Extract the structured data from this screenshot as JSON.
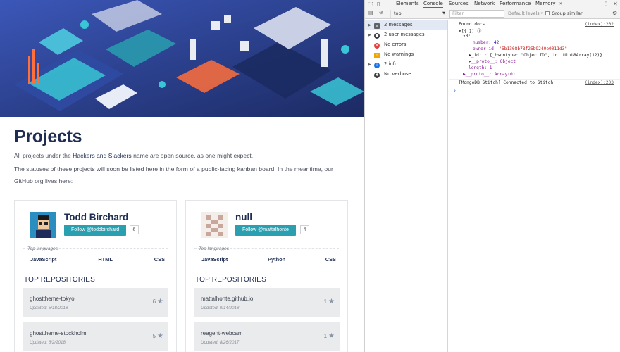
{
  "page": {
    "title": "Projects",
    "intro_prefix": "All projects under the ",
    "intro_link": "Hackers and Slackers",
    "intro_suffix": " name are open source, as one might expect.",
    "status_line1": "The statuses of these projects will soon be listed here in the form of a public-facing kanban board. In the meantime, our",
    "status_line2": "GitHub org lives here:",
    "cards": [
      {
        "name": "Todd Birchard",
        "follow_label": "Follow @toddbirchard",
        "follower_count": "6",
        "top_languages_label": "Top languages",
        "languages": [
          "JavaScript",
          "HTML",
          "CSS"
        ],
        "repos_heading": "TOP REPOSITORIES",
        "repos": [
          {
            "name": "ghosttheme-tokyo",
            "updated": "Updated: 5/18/2018",
            "stars": "6"
          },
          {
            "name": "ghosttheme-stockholm",
            "updated": "Updated: 6/2/2018",
            "stars": "5"
          }
        ]
      },
      {
        "name": "null",
        "follow_label": "Follow @mattalhonte",
        "follower_count": "4",
        "top_languages_label": "Top languages",
        "languages": [
          "JavaScript",
          "Python",
          "CSS"
        ],
        "repos_heading": "TOP REPOSITORIES",
        "repos": [
          {
            "name": "mattalhonte.github.io",
            "updated": "Updated: 9/14/2018",
            "stars": "1"
          },
          {
            "name": "reagent-webcam",
            "updated": "Updated: 8/26/2017",
            "stars": "1"
          }
        ]
      }
    ]
  },
  "devtools": {
    "tabs": [
      "Elements",
      "Console",
      "Sources",
      "Network",
      "Performance",
      "Memory"
    ],
    "active_tab": "Console",
    "more_tabs": "»",
    "context": "top",
    "filter_placeholder": "Filter",
    "levels_label": "Default levels ▾",
    "group_similar": "Group similar",
    "sidebar": [
      {
        "label": "2 messages",
        "icon": "list-icon",
        "color": "#5f6368"
      },
      {
        "label": "2 user messages",
        "icon": "user-icon",
        "color": "#5f6368"
      },
      {
        "label": "No errors",
        "icon": "error-icon",
        "color": "#e0443e"
      },
      {
        "label": "No warnings",
        "icon": "warning-icon",
        "color": "#f2a600"
      },
      {
        "label": "2 info",
        "icon": "info-icon",
        "color": "#1a73e8"
      },
      {
        "label": "No verbose",
        "icon": "bug-icon",
        "color": "#5f6368"
      }
    ],
    "console": {
      "line1": "Found docs",
      "line1_src": "(index):202",
      "line2": "▾[{…}] ⓘ",
      "line3": "▾0:",
      "number_key": "number:",
      "number_val": "42",
      "owner_key": "owner_id:",
      "owner_val": "\"5b1308b78f25b9240e0011d3\"",
      "id_line": "▶_id: r {_bsontype: \"ObjectID\", id: Uint8Array(12)}",
      "proto1": "▶__proto__: Object",
      "length_line": "length: 1",
      "proto2": "▶__proto__: Array(0)",
      "line4": "[MongoDB Stitch] Connected to Stitch",
      "line4_src": "(index):203",
      "prompt": "›"
    }
  },
  "colors": {
    "accent": "#2a9fb0",
    "title": "#1f2d52",
    "devtools_tab_active": "#1a73e8"
  }
}
